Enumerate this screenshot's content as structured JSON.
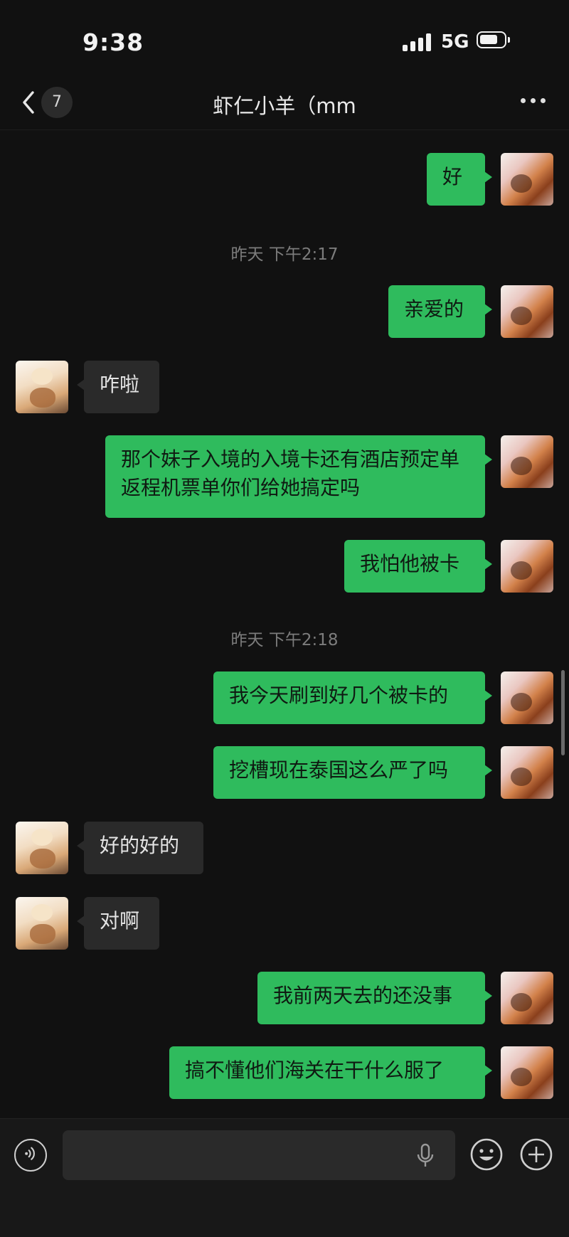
{
  "status": {
    "time": "9:38",
    "network": "5G"
  },
  "header": {
    "back_badge": "7",
    "title": "虾仁小羊（mm"
  },
  "messages": [
    {
      "from": "me",
      "text": "好"
    },
    {
      "type": "time",
      "text": "昨天 下午2:17"
    },
    {
      "from": "me",
      "text": "亲爱的"
    },
    {
      "from": "them",
      "text": "咋啦"
    },
    {
      "from": "me",
      "text": "那个妹子入境的入境卡还有酒店预定单返程机票单你们给她搞定吗"
    },
    {
      "from": "me",
      "text": "我怕他被卡"
    },
    {
      "type": "time",
      "text": "昨天 下午2:18"
    },
    {
      "from": "me",
      "text": "我今天刷到好几个被卡的"
    },
    {
      "from": "me",
      "text": "挖槽现在泰国这么严了吗"
    },
    {
      "from": "them",
      "text": "好的好的"
    },
    {
      "from": "them",
      "text": "对啊"
    },
    {
      "from": "me",
      "text": "我前两天去的还没事"
    },
    {
      "from": "me",
      "text": "搞不懂他们海关在干什么服了"
    }
  ],
  "input": {
    "value": ""
  },
  "icons": {
    "back": "chevron-left-icon",
    "more": "more-icon",
    "voice": "voice-icon",
    "mic": "mic-icon",
    "emoji": "emoji-icon",
    "add": "plus-icon"
  },
  "colors": {
    "background": "#111111",
    "my_bubble": "#2fbb5d",
    "their_bubble": "#2a2a2a",
    "timestamp": "#7c7c7c"
  }
}
